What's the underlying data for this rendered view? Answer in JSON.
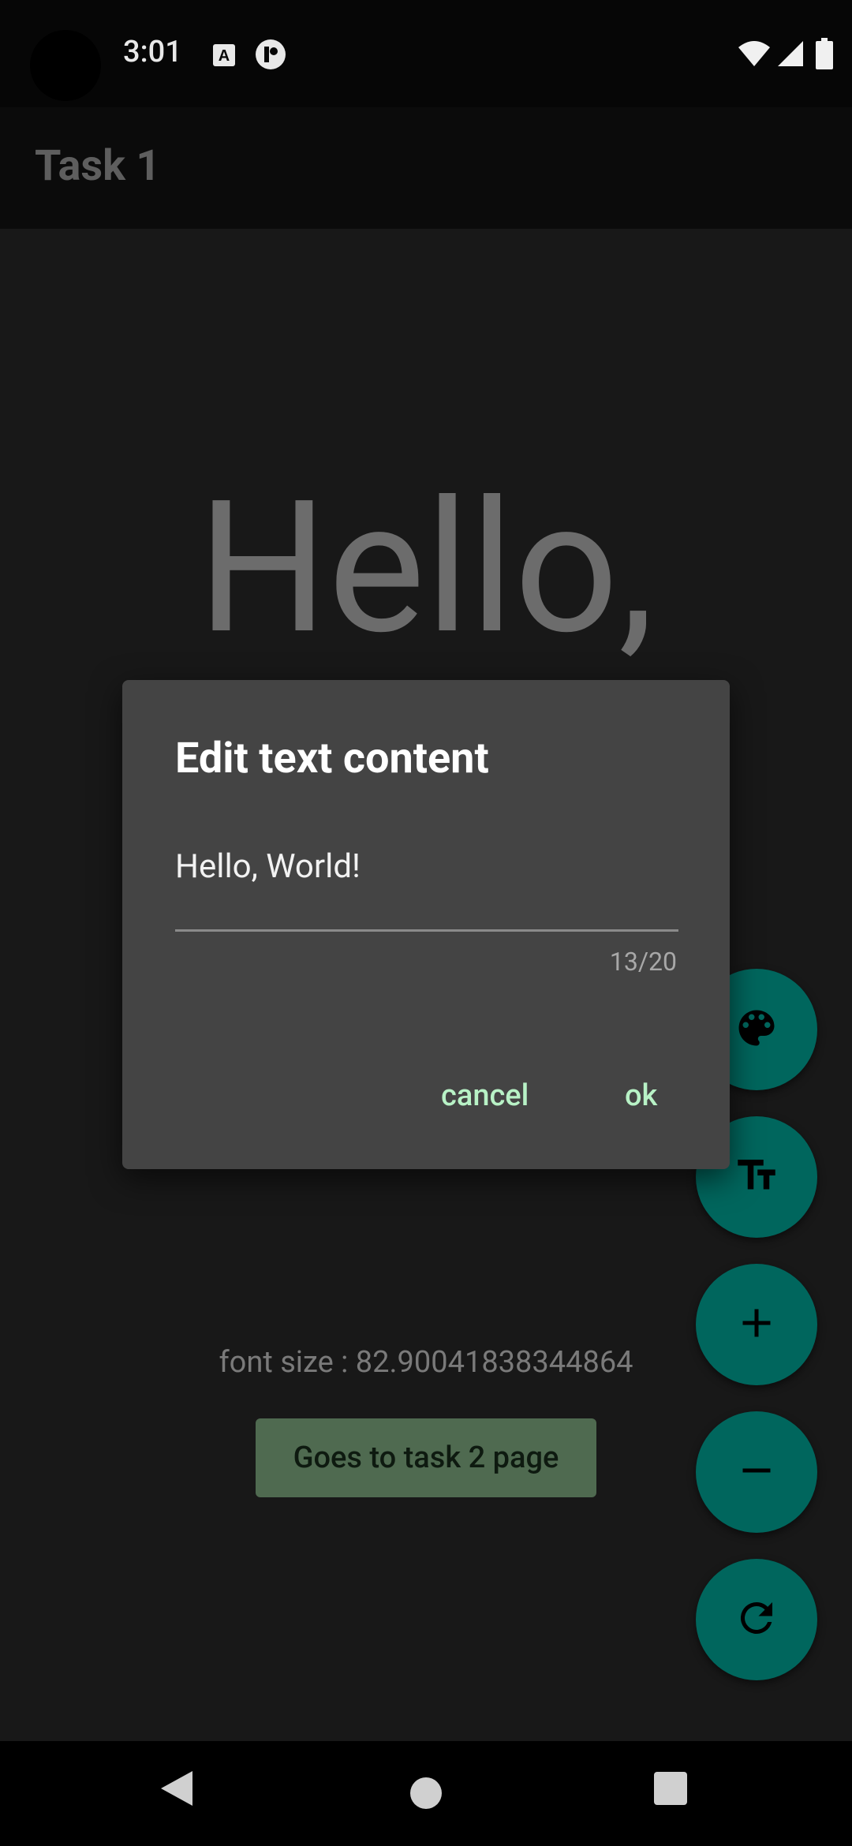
{
  "status_bar": {
    "time": "3:01"
  },
  "app_bar": {
    "title": "Task 1"
  },
  "main": {
    "display_text": "Hello,",
    "font_size_label": "font size : 82.90041838344864",
    "navigate_button_label": "Goes to task 2 page"
  },
  "dialog": {
    "title": "Edit text content",
    "input_value": "Hello, World!",
    "counter": "13/20",
    "cancel_label": "cancel",
    "ok_label": "ok"
  },
  "fabs": [
    "palette-icon",
    "text-size-icon",
    "plus-icon",
    "minus-icon",
    "refresh-icon"
  ],
  "colors": {
    "fab": "#00665d",
    "dialog_bg": "#444444",
    "dialog_action": "#b8f2c6",
    "navigate_button": "#4f6a50"
  }
}
